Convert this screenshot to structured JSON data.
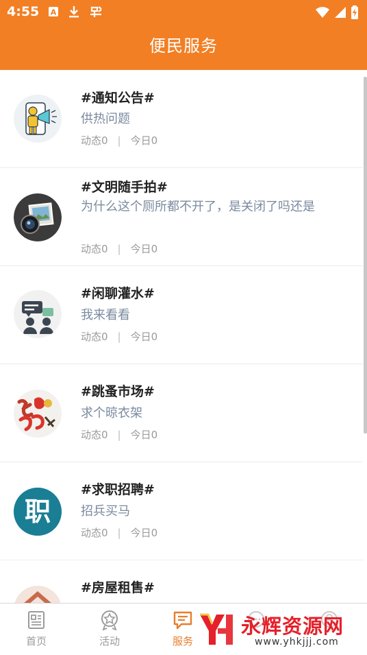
{
  "status_bar": {
    "time": "4:55",
    "left_icons": [
      "a-box-icon",
      "download-icon",
      "bug-icon"
    ],
    "right_icons": [
      "wifi-icon",
      "signal-icon",
      "battery-charging-icon"
    ]
  },
  "header": {
    "title": "便民服务"
  },
  "items": [
    {
      "title": "#通知公告#",
      "desc": "供热问题",
      "stats": {
        "dynamic": "动态0",
        "sep": "|",
        "today": "今日0"
      },
      "icon": "megaphone-icon"
    },
    {
      "title": "#文明随手拍#",
      "desc": "为什么这个厕所都不开了，是关闭了吗还是",
      "stats": {
        "dynamic": "动态0",
        "sep": "|",
        "today": "今日0"
      },
      "icon": "camera-icon"
    },
    {
      "title": "#闲聊灌水#",
      "desc": "我来看看",
      "stats": {
        "dynamic": "动态0",
        "sep": "|",
        "today": "今日0"
      },
      "icon": "chat-people-icon"
    },
    {
      "title": "#跳蚤市场#",
      "desc": "求个晾衣架",
      "stats": {
        "dynamic": "动态0",
        "sep": "|",
        "today": "今日0"
      },
      "icon": "flea-market-logo"
    },
    {
      "title": "#求职招聘#",
      "desc": "招兵买马",
      "stats": {
        "dynamic": "动态0",
        "sep": "|",
        "today": "今日0"
      },
      "icon": "job-icon",
      "icon_text": "职"
    },
    {
      "title": "#房屋租售#",
      "icon": "house-icon"
    }
  ],
  "tabbar": {
    "tabs": [
      {
        "label": "首页",
        "icon": "news-icon",
        "active": false
      },
      {
        "label": "活动",
        "icon": "badge-star-icon",
        "active": false
      },
      {
        "label": "服务",
        "icon": "service-chat-icon",
        "active": true
      },
      {
        "label": "",
        "icon": "chat-icon",
        "active": false
      },
      {
        "label": "",
        "icon": "user-icon",
        "active": false
      }
    ]
  },
  "watermark": {
    "brand": "永辉资源网",
    "url": "www.yhkjjj.com"
  },
  "colors": {
    "accent": "#f27f24",
    "active_tab": "#e87d2a",
    "desc_text": "#7a8a9e"
  }
}
